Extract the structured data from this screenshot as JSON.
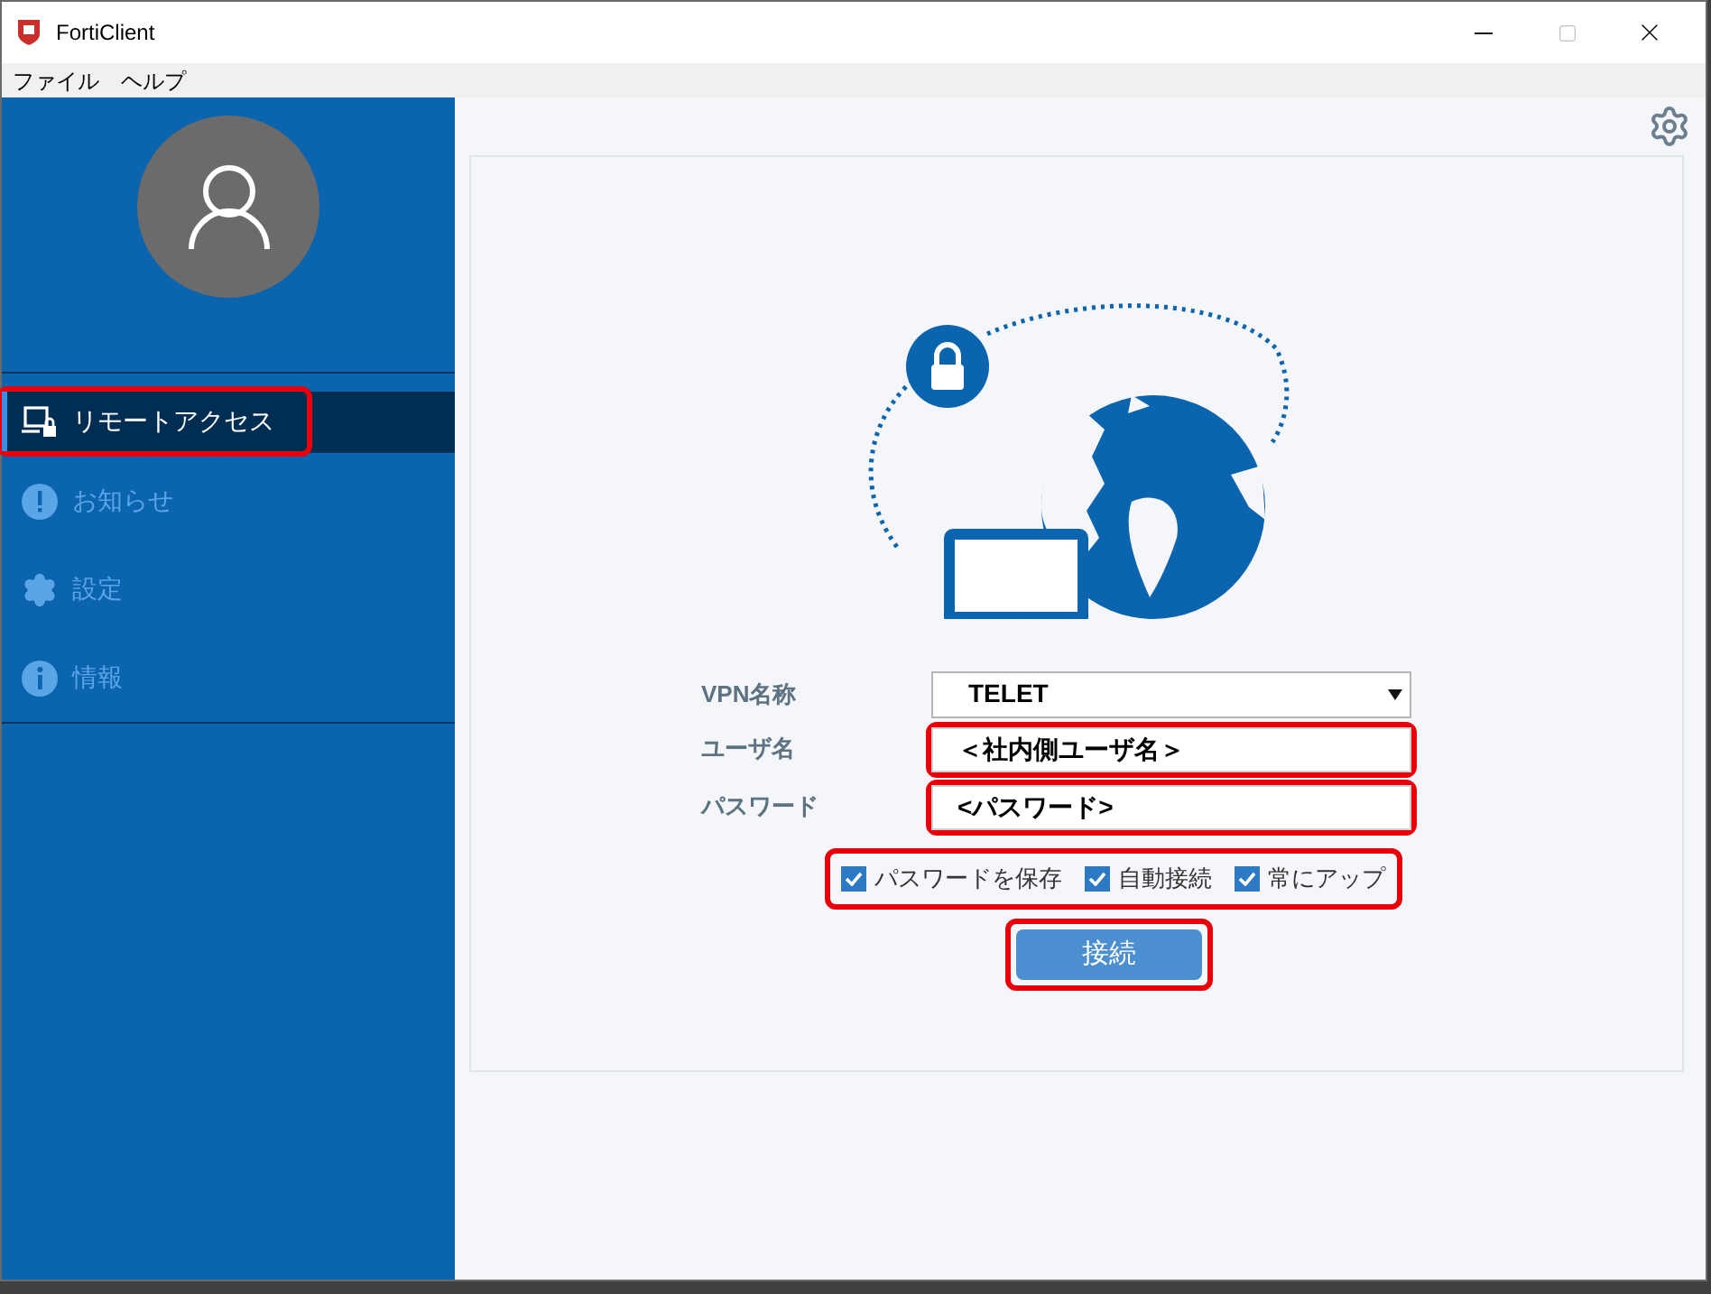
{
  "window": {
    "title": "FortiClient"
  },
  "menu": [
    "ファイル",
    "ヘルプ"
  ],
  "sidebar": {
    "items": [
      {
        "kind": "remote",
        "label": "リモートアクセス",
        "selected": true,
        "highlighted": true
      },
      {
        "kind": "notice",
        "label": "お知らせ",
        "selected": false,
        "highlighted": false
      },
      {
        "kind": "settings",
        "label": "設定",
        "selected": false,
        "highlighted": false
      },
      {
        "kind": "info",
        "label": "情報",
        "selected": false,
        "highlighted": false
      }
    ]
  },
  "form": {
    "vpn_name": {
      "label": "VPN名称",
      "value": "TELET",
      "highlighted": false
    },
    "username": {
      "label": "ユーザ名",
      "value": "＜社内側ユーザ名＞",
      "highlighted": true
    },
    "password": {
      "label": "パスワード",
      "value": "<パスワード>",
      "highlighted": true
    },
    "options": {
      "highlighted": true,
      "items": [
        {
          "label": "パスワードを保存",
          "checked": true
        },
        {
          "label": "自動接続",
          "checked": true
        },
        {
          "label": "常にアップ",
          "checked": true
        }
      ]
    },
    "connect_button": {
      "label": "接続",
      "highlighted": true
    }
  }
}
